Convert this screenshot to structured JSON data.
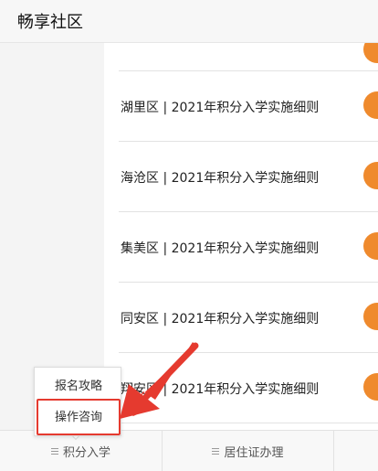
{
  "header": {
    "title": "畅享社区"
  },
  "list": {
    "items": [
      {
        "label": ""
      },
      {
        "label": "湖里区 | 2021年积分入学实施细则"
      },
      {
        "label": "海沧区 | 2021年积分入学实施细则"
      },
      {
        "label": "集美区 | 2021年积分入学实施细则"
      },
      {
        "label": "同安区 | 2021年积分入学实施细则"
      },
      {
        "label": "翔安区 | 2021年积分入学实施细则"
      }
    ]
  },
  "popup": {
    "items": [
      {
        "label": "报名攻略"
      },
      {
        "label": "操作咨询"
      }
    ]
  },
  "tabbar": {
    "tabs": [
      {
        "label": "积分入学"
      },
      {
        "label": "居住证办理"
      },
      {
        "label": ""
      }
    ]
  },
  "colors": {
    "accent_orange": "#ef8a2d",
    "annotation_red": "#e53a2f"
  }
}
